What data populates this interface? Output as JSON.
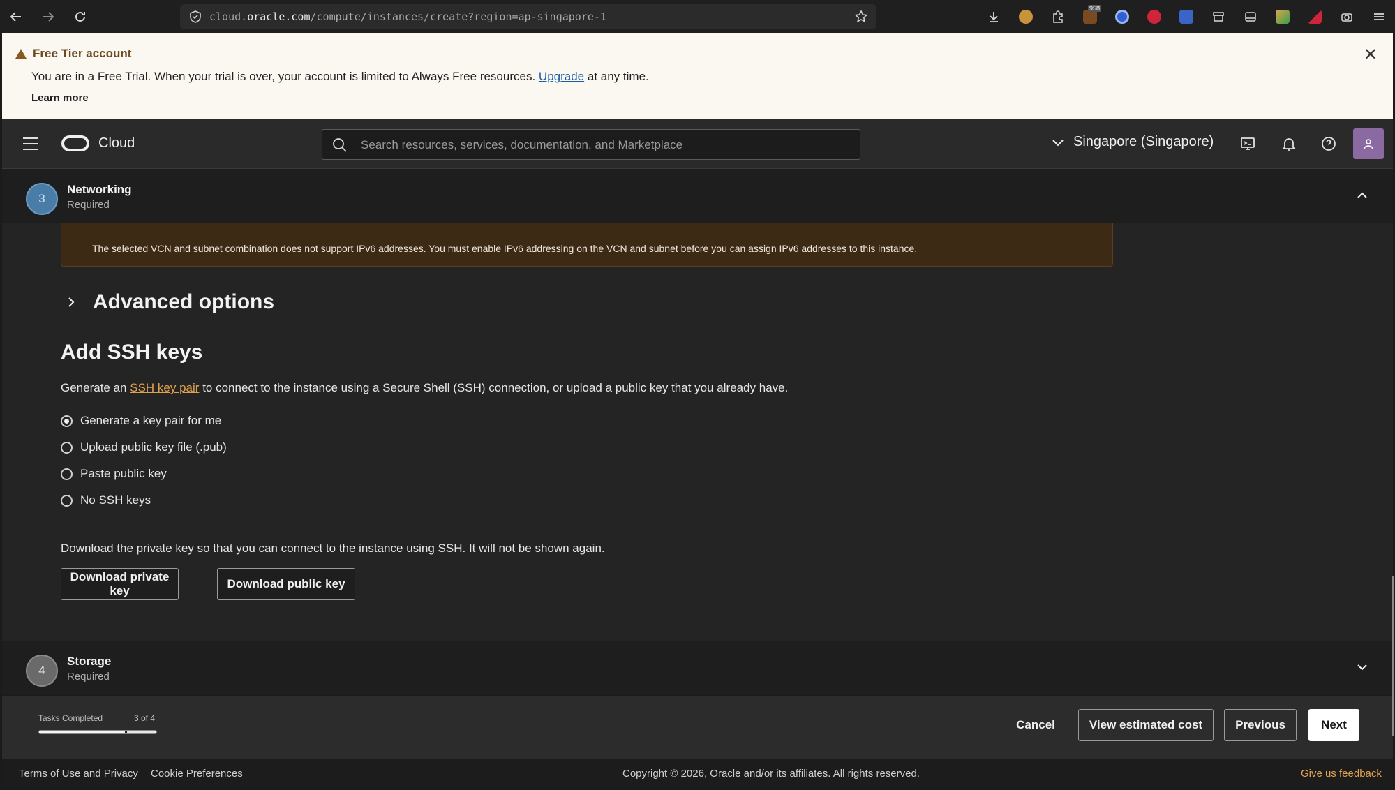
{
  "browser": {
    "url_prefix": "cloud.",
    "url_host": "oracle.com",
    "url_path": "/compute/instances/create?region=ap-singapore-1",
    "badge_count": "958"
  },
  "banner": {
    "title": "Free Tier account",
    "text_before": "You are in a Free Trial. When your trial is over, your account is limited to Always Free resources.",
    "upgrade_link": "Upgrade",
    "text_after": "at any time.",
    "learn_more": "Learn more"
  },
  "header": {
    "brand": "Cloud",
    "search_placeholder": "Search resources, services, documentation, and Marketplace",
    "region": "Singapore (Singapore)"
  },
  "steps": {
    "networking": {
      "number": "3",
      "title": "Networking",
      "subtitle": "Required"
    },
    "storage": {
      "number": "4",
      "title": "Storage",
      "subtitle": "Required"
    }
  },
  "content": {
    "ipv6_warning": "The selected VCN and subnet combination does not support IPv6 addresses. You must enable IPv6 addressing on the VCN and subnet before you can assign IPv6 addresses to this instance.",
    "advanced_options": "Advanced options",
    "ssh_title": "Add SSH keys",
    "ssh_desc_before": "Generate an",
    "ssh_desc_link": "SSH key pair",
    "ssh_desc_after": "to connect to the instance using a Secure Shell (SSH) connection, or upload a public key that you already have.",
    "radio_options": [
      {
        "label": "Generate a key pair for me",
        "selected": true
      },
      {
        "label": "Upload public key file (.pub)",
        "selected": false
      },
      {
        "label": "Paste public key",
        "selected": false
      },
      {
        "label": "No SSH keys",
        "selected": false
      }
    ],
    "download_text": "Download the private key so that you can connect to the instance using SSH. It will not be shown again.",
    "download_private": "Download private key",
    "download_public": "Download public key"
  },
  "action_bar": {
    "tasks_label": "Tasks Completed",
    "tasks_count": "3 of 4",
    "tasks_fraction": 0.75,
    "cancel": "Cancel",
    "view_cost": "View estimated cost",
    "previous": "Previous",
    "next": "Next"
  },
  "footer": {
    "terms": "Terms of Use and Privacy",
    "cookies": "Cookie Preferences",
    "copyright": "Copyright © 2026, Oracle and/or its affiliates. All rights reserved.",
    "feedback": "Give us feedback"
  },
  "colors": {
    "accent_link": "#e0a24e",
    "warning_bg": "#3d2a14",
    "banner_bg": "#fbf8f2",
    "step_active": "#4a7ca8"
  }
}
